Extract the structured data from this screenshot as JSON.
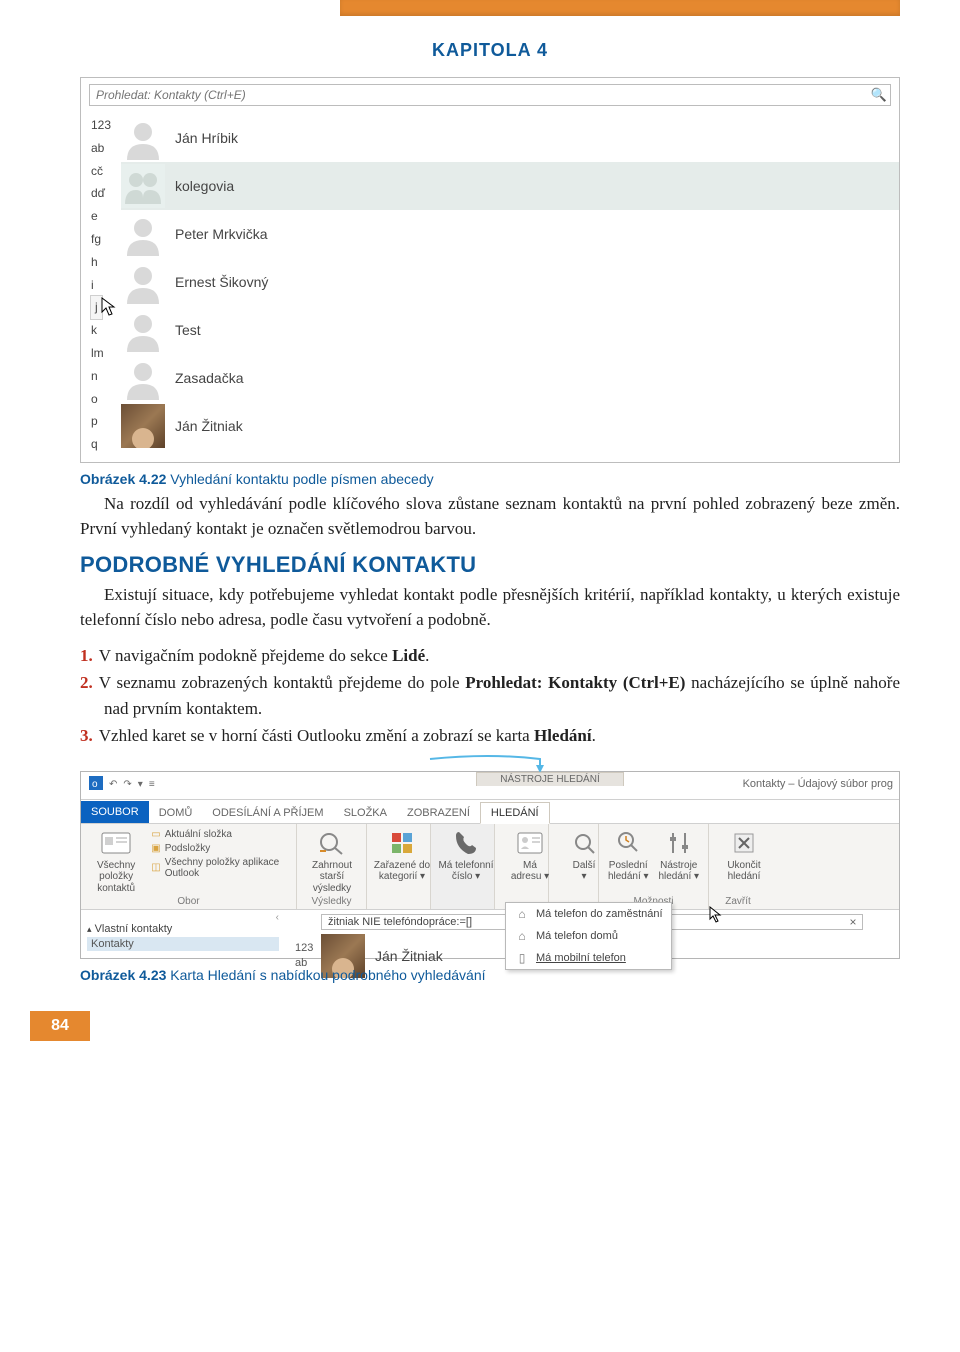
{
  "chapter_label": "KAPITOLA 4",
  "page_number": "84",
  "fig422": {
    "search_placeholder": "Prohledat: Kontakty (Ctrl+E)",
    "letters": [
      "123",
      "ab",
      "cč",
      "dď",
      "e",
      "fg",
      "h",
      "i",
      "j",
      "k",
      "lm",
      "n",
      "o",
      "p",
      "q"
    ],
    "hot_letter_index": 8,
    "contacts": [
      {
        "name": "Ján Hríbik",
        "type": "person"
      },
      {
        "name": "kolegovia",
        "type": "group",
        "selected": true
      },
      {
        "name": "Peter Mrkvička",
        "type": "person"
      },
      {
        "name": "Ernest Šikovný",
        "type": "person"
      },
      {
        "name": "Test",
        "type": "person"
      },
      {
        "name": "Zasadačka",
        "type": "person"
      },
      {
        "name": "Ján Žitniak",
        "type": "photo"
      }
    ]
  },
  "caption422_b": "Obrázek 4.22",
  "caption422_rest": " Vyhledání kontaktu podle písmen abecedy",
  "para1": "Na rozdíl od vyhledávání podle klíčového slova zůstane seznam kontaktů na první pohled zobrazený beze změn. První vyhledaný kontakt je označen světlemodrou barvou.",
  "section_heading": "PODROBNÉ VYHLEDÁNÍ KONTAKTU",
  "para2": "Existují situace, kdy potřebujeme vyhledat kontakt podle přesnějších kritérií, například kontakty, u kterých existuje telefonní číslo nebo adresa, podle času vytvoření a podobně.",
  "list": [
    {
      "n": "1.",
      "pre": "V navigačním podokně přejdeme do sekce ",
      "b": "Lidé",
      "post": "."
    },
    {
      "n": "2.",
      "pre": "V seznamu zobrazených kontaktů přejdeme do pole ",
      "b": "Prohledat: Kontakty (Ctrl+E)",
      "post": " nacházejícího se úplně nahoře nad prvním kontaktem."
    },
    {
      "n": "3.",
      "pre": "Vzhled karet se v horní části Outlooku změní a zobrazí se karta ",
      "b": "Hledání",
      "post": "."
    }
  ],
  "fig423": {
    "contextual_heading": "NÁSTROJE HLEDÁNÍ",
    "window_title": "Kontakty – Údajový súbor prog",
    "qat_items": [
      "↶",
      "↷",
      "▾",
      "≡"
    ],
    "tabs": [
      "SOUBOR",
      "DOMŮ",
      "ODESÍLÁNÍ A PŘÍJEM",
      "SLOŽKA",
      "ZOBRAZENÍ",
      "HLEDÁNÍ"
    ],
    "active_tab": 5,
    "group_obor": {
      "big_label": "Všechny položky kontaktů",
      "side": [
        {
          "icon": "▭",
          "label": "Aktuální složka"
        },
        {
          "icon": "▣",
          "label": "Podsložky"
        },
        {
          "icon": "◫",
          "label": "Všechny položky aplikace Outlook"
        }
      ],
      "label": "Obor"
    },
    "group_vysledky": {
      "big_label": "Zahrnout starší výsledky",
      "label": "Výsledky"
    },
    "group_kat": {
      "label1": "Zařazené do",
      "label2": "kategorií ▾"
    },
    "group_tel": {
      "label1": "Má telefonní",
      "label2": "číslo ▾"
    },
    "group_adr": {
      "label1": "Má",
      "label2": "adresu ▾"
    },
    "group_dalsi": {
      "label1": "Další",
      "label2": "▾"
    },
    "group_posl": {
      "label1": "Poslední",
      "label2": "hledání ▾"
    },
    "group_nast": {
      "label1": "Nástroje",
      "label2": "hledání ▾"
    },
    "group_uk": {
      "label1": "Ukončit",
      "label2": "hledání"
    },
    "group_moz_label": "Možnosti",
    "group_zavrit_label": "Zavřít",
    "dd_items": [
      {
        "icon": "⌂",
        "label": "Má telefon do zaměstnání"
      },
      {
        "icon": "⌂",
        "label": "Má telefon domů"
      },
      {
        "icon": "▯",
        "label": "Má mobilní telefon",
        "u": true
      }
    ],
    "nav_section": "Vlastní kontakty",
    "nav_item": "Kontakty",
    "search2_value": "žitniak NIE telefóndopráce:=[]",
    "letters2": [
      "123",
      "ab"
    ],
    "contact2_name": "Ján Žitniak"
  },
  "caption423_b": "Obrázek 4.23",
  "caption423_rest": " Karta Hledání s nabídkou podrobného vyhledávání"
}
